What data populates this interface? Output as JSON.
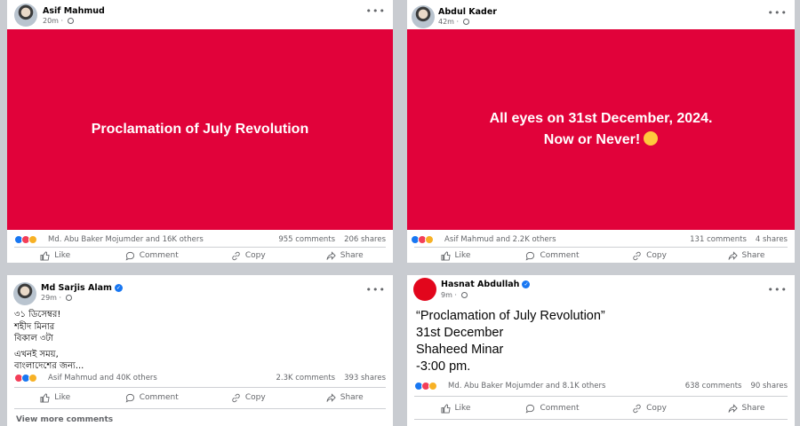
{
  "posts": [
    {
      "author": "Asif Mahmud",
      "time": "20m",
      "banner": "Proclamation of July Revolution",
      "reactions": "Md. Abu Baker Mojumder and 16K others",
      "comments": "955 comments",
      "shares": "206 shares"
    },
    {
      "author": "Abdul Kader",
      "time": "42m",
      "banner_line1": "All eyes on 31st December, 2024.",
      "banner_line2": "Now or Never!",
      "reactions": "Asif Mahmud and 2.2K others",
      "comments": "131 comments",
      "shares": "4 shares"
    },
    {
      "author": "Md Sarjis Alam",
      "time": "29m",
      "lines": [
        "৩১ ডিসেম্বর!",
        "শহীদ মিনার",
        "বিকাল ৩টা",
        "এখনই সময়,",
        "বাংলাদেশের জন্য..."
      ],
      "reactions": "Asif Mahmud and 40K others",
      "comments": "2.3K comments",
      "shares": "393 shares",
      "view_more": "View more comments"
    },
    {
      "author": "Hasnat Abdullah",
      "time": "9m",
      "lines": [
        "“Proclamation of July Revolution”",
        "31st December",
        "Shaheed Minar",
        "-3:00 pm."
      ],
      "reactions": "Md. Abu Baker Mojumder and 8.1K others",
      "comments": "638 comments",
      "shares": "90 shares"
    }
  ],
  "actions": {
    "like": "Like",
    "comment": "Comment",
    "copy": "Copy",
    "share": "Share"
  },
  "icons": {
    "more": "more-dots-icon",
    "privacy": "globe-icon",
    "verified": "verified-badge-icon"
  },
  "colors": {
    "banner": "#e1023a",
    "page_bg": "#c9ccd1",
    "link_blue": "#1877f2"
  }
}
